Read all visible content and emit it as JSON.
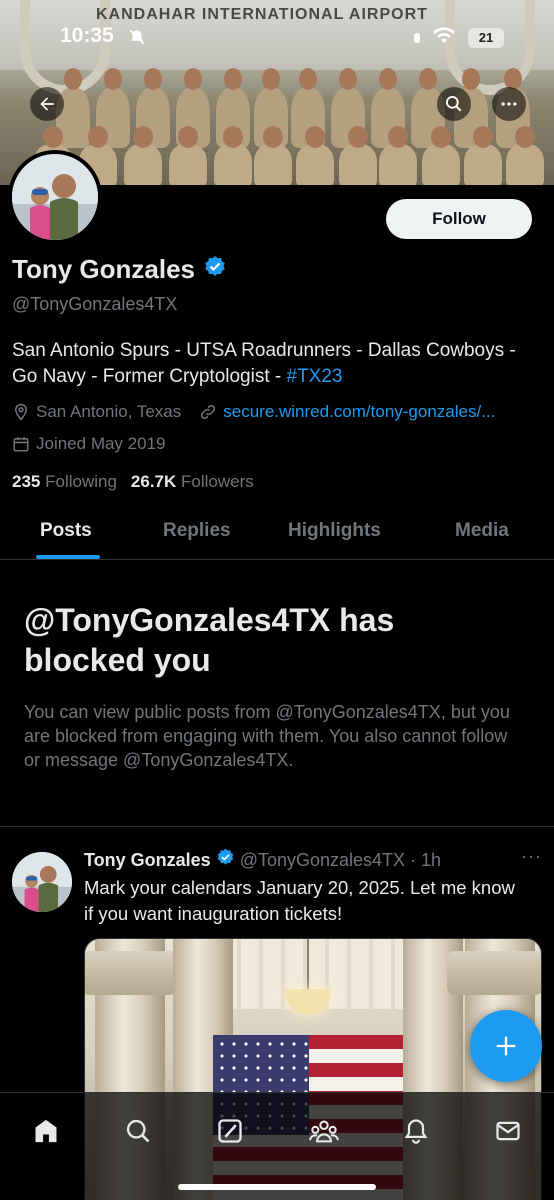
{
  "status_bar": {
    "time": "10:35",
    "battery": "21"
  },
  "banner": {
    "sign_text": "KANDAHAR INTERNATIONAL AIRPORT"
  },
  "profile": {
    "name": "Tony Gonzales",
    "handle": "@TonyGonzales4TX",
    "bio_text": "San Antonio Spurs - UTSA Roadrunners - Dallas Cowboys - Go Navy - Former Cryptologist - ",
    "bio_hashtag": "#TX23",
    "location": "San Antonio, Texas",
    "website": "secure.winred.com/tony-gonzales/...",
    "joined": "Joined May 2019",
    "following_count": "235",
    "following_label": "Following",
    "followers_count": "26.7K",
    "followers_label": "Followers",
    "follow_button": "Follow"
  },
  "tabs": [
    "Posts",
    "Replies",
    "Highlights",
    "Media"
  ],
  "blocked_notice": {
    "title": "@TonyGonzales4TX has blocked you",
    "body": "You can view public posts from @TonyGonzales4TX, but you are blocked from engaging with them. You also cannot follow or message @TonyGonzales4TX."
  },
  "post": {
    "author_name": "Tony Gonzales",
    "author_handle": "@TonyGonzales4TX",
    "time": "· 1h",
    "text": "Mark your calendars January 20, 2025. Let me know if you want inauguration tickets!",
    "more": "···"
  },
  "bottom_nav": [
    "home-icon",
    "search-icon",
    "grok-icon",
    "communities-icon",
    "notifications-icon",
    "messages-icon"
  ],
  "colors": {
    "accent": "#1d9bf0",
    "background": "#000000",
    "text": "#e7e9ea",
    "muted": "#71767b"
  }
}
